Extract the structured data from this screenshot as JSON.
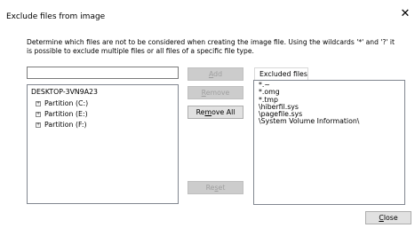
{
  "window": {
    "title": "Exclude files from image",
    "close_glyph": "✕"
  },
  "description": "Determine which files are not to be considered when creating the image file. Using the wildcards '*' and '?' it is possible to exclude multiple files or all files of a specific file type.",
  "input": {
    "value": "",
    "placeholder": ""
  },
  "tree": {
    "root": "DESKTOP-3VN9A23",
    "items": [
      {
        "label": "Partition (C:)",
        "expander": "+"
      },
      {
        "label": "Partition (E:)",
        "expander": "+"
      },
      {
        "label": "Partition (F:)",
        "expander": "+"
      }
    ]
  },
  "buttons": {
    "add": {
      "label": "Add",
      "enabled": false
    },
    "remove": {
      "label": "Remove",
      "enabled": false
    },
    "remove_all": {
      "label": "Remove All",
      "enabled": true
    },
    "reset": {
      "label": "Reset",
      "enabled": false
    },
    "close": {
      "label": "Close",
      "enabled": true
    }
  },
  "excluded": {
    "tab_label": "Excluded files",
    "items": [
      "*.~",
      "*.omg",
      "*.tmp",
      "\\hiberfil.sys",
      "\\pagefile.sys",
      "\\System Volume Information\\"
    ]
  }
}
